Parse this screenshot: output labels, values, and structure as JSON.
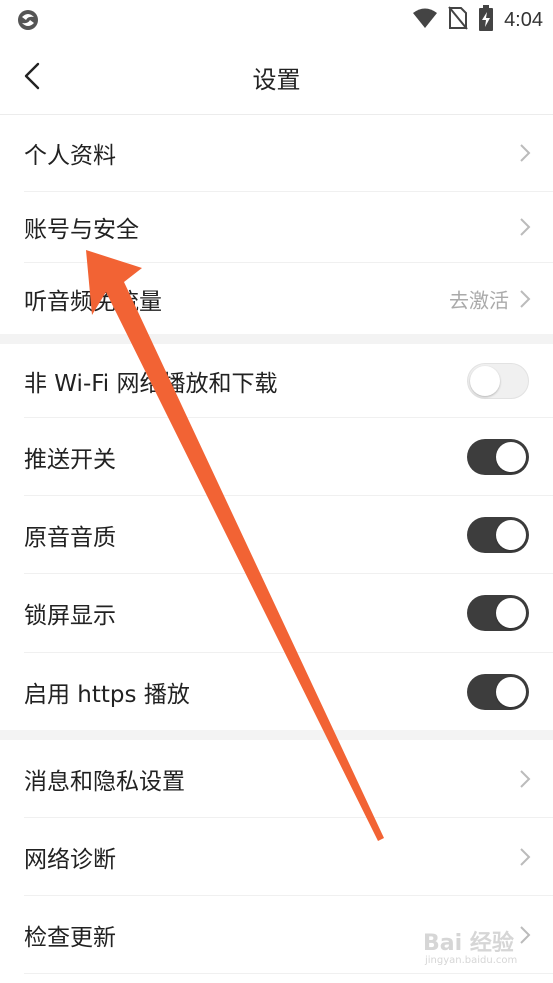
{
  "status_bar": {
    "time": "4:04",
    "icons": [
      "app-logo-icon",
      "wifi-icon",
      "no-sim-icon",
      "battery-charging-icon"
    ]
  },
  "header": {
    "title": "设置",
    "back_icon": "chevron-left-icon"
  },
  "groups": [
    {
      "items": [
        {
          "label": "个人资料",
          "type": "link"
        },
        {
          "label": "账号与安全",
          "type": "link"
        },
        {
          "label": "听音频免流量",
          "type": "link",
          "value": "去激活"
        }
      ]
    },
    {
      "items": [
        {
          "label": "非 Wi-Fi 网络播放和下载",
          "type": "toggle",
          "on": false
        },
        {
          "label": "推送开关",
          "type": "toggle",
          "on": true
        },
        {
          "label": "原音音质",
          "type": "toggle",
          "on": true
        },
        {
          "label": "锁屏显示",
          "type": "toggle",
          "on": true
        },
        {
          "label": "启用 https 播放",
          "type": "toggle",
          "on": true
        }
      ]
    },
    {
      "items": [
        {
          "label": "消息和隐私设置",
          "type": "link"
        },
        {
          "label": "网络诊断",
          "type": "link"
        },
        {
          "label": "检查更新",
          "type": "link"
        }
      ]
    }
  ],
  "colors": {
    "toggle_on": "#3d3d3d",
    "toggle_off": "#f0f0f0",
    "annotation_arrow": "#f26334",
    "divider": "#f0f0f0",
    "group_gap": "#f3f3f3"
  },
  "watermark": {
    "text": "Bai 经验",
    "url": "jingyan.baidu.com"
  }
}
